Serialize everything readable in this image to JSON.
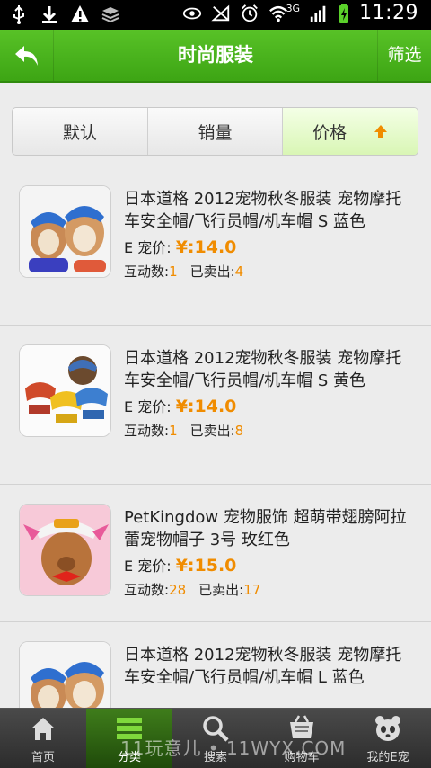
{
  "status_bar": {
    "time": "11:29",
    "network": "3G",
    "icons": [
      "usb-icon",
      "download-icon",
      "warning-icon",
      "stack-icon",
      "eye-icon",
      "no-signal-icon",
      "alarm-icon",
      "wifi-icon",
      "signal-icon",
      "battery-charging-icon"
    ]
  },
  "header": {
    "back_icon": "back-arrow-icon",
    "title": "时尚服装",
    "filter_label": "筛选"
  },
  "sort": {
    "tabs": [
      {
        "label": "默认",
        "active": false
      },
      {
        "label": "销量",
        "active": false
      },
      {
        "label": "价格",
        "active": true
      }
    ],
    "arrow_icon": "sort-up-arrow-icon"
  },
  "products": [
    {
      "title": "日本道格 2012宠物秋冬服装 宠物摩托车安全帽/飞行员帽/机车帽 S 蓝色",
      "price_label": "E 宠价:",
      "price": "¥:14.0",
      "interact_label": "互动数:",
      "interact_count": "1",
      "sold_label": "已卖出:",
      "sold_count": "4"
    },
    {
      "title": "日本道格 2012宠物秋冬服装 宠物摩托车安全帽/飞行员帽/机车帽 S 黄色",
      "price_label": "E 宠价:",
      "price": "¥:14.0",
      "interact_label": "互动数:",
      "interact_count": "1",
      "sold_label": "已卖出:",
      "sold_count": "8"
    },
    {
      "title": "PetKingdow 宠物服饰 超萌带翅膀阿拉蕾宠物帽子 3号 玫红色",
      "price_label": "E 宠价:",
      "price": "¥:15.0",
      "interact_label": "互动数:",
      "interact_count": "28",
      "sold_label": "已卖出:",
      "sold_count": "17"
    },
    {
      "title": "日本道格 2012宠物秋冬服装 宠物摩托车安全帽/飞行员帽/机车帽 L 蓝色"
    }
  ],
  "bottom_nav": [
    {
      "label": "首页",
      "icon": "home-icon",
      "active": false
    },
    {
      "label": "分类",
      "icon": "category-icon",
      "active": true
    },
    {
      "label": "搜索",
      "icon": "search-icon",
      "active": false
    },
    {
      "label": "购物车",
      "icon": "cart-icon",
      "active": false
    },
    {
      "label": "我的E宠",
      "icon": "panda-icon",
      "active": false
    }
  ],
  "watermark": "11玩意儿 • 11WYX.COM",
  "colors": {
    "brand_green": "#4cb51e",
    "price_orange": "#f08c00",
    "active_tab": "#d9f6b5"
  }
}
